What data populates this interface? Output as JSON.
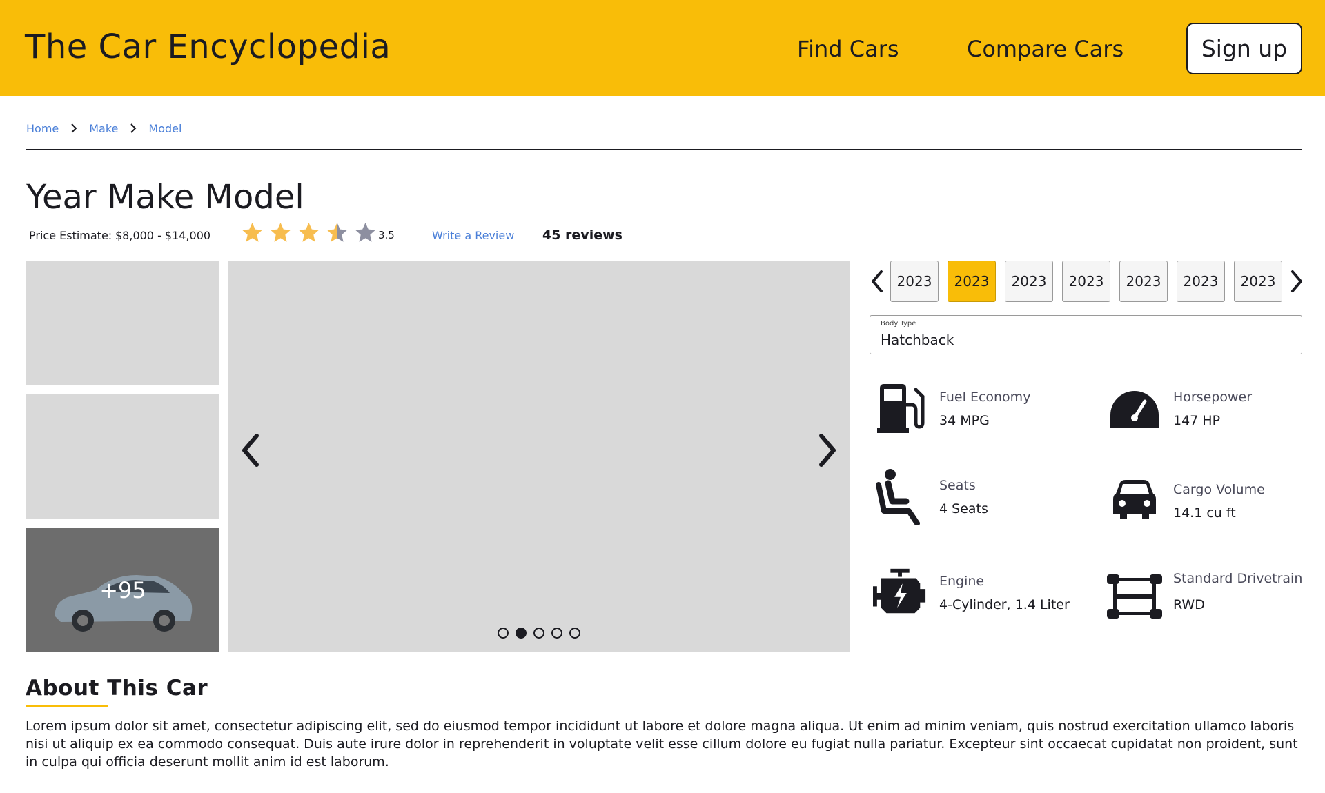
{
  "header": {
    "brand": "The Car Encyclopedia",
    "nav": {
      "find_cars": "Find Cars",
      "compare_cars": "Compare Cars"
    },
    "signup_label": "Sign up",
    "background_color": "#f9bd08"
  },
  "breadcrumb": [
    "Home",
    "Make",
    "Model"
  ],
  "car": {
    "title": "Year Make Model",
    "price_label": "Price Estimate:",
    "price_value": "$8,000 - $14,000",
    "rating": 3.5,
    "rating_text": "3.5",
    "rating_max": 5,
    "write_review": "Write a Review",
    "review_count": "45 reviews"
  },
  "gallery": {
    "more_count": "+95",
    "slide_count": 5,
    "active_slide": 2
  },
  "years": {
    "items": [
      "2023",
      "2023",
      "2023",
      "2023",
      "2023",
      "2023",
      "2023"
    ],
    "active_index": 1
  },
  "body_type": {
    "label": "Body Type",
    "value": "Hatchback"
  },
  "specs": {
    "fuel_economy": {
      "label": "Fuel Economy",
      "value": "34 MPG",
      "icon": "fuel-pump-icon"
    },
    "horsepower": {
      "label": "Horsepower",
      "value": "147 HP",
      "icon": "speedometer-icon"
    },
    "seats": {
      "label": "Seats",
      "value": "4 Seats",
      "icon": "seat-icon"
    },
    "cargo_volume": {
      "label": "Cargo Volume",
      "value": "14.1 cu ft",
      "icon": "car-front-icon"
    },
    "engine": {
      "label": "Engine",
      "value": "4-Cylinder, 1.4 Liter",
      "icon": "engine-icon"
    },
    "drivetrain": {
      "label": "Standard Drivetrain",
      "value": "RWD",
      "icon": "drivetrain-icon"
    }
  },
  "about": {
    "title": "About This Car",
    "text": "Lorem ipsum dolor sit amet, consectetur adipiscing elit, sed do eiusmod tempor incididunt ut labore et dolore magna aliqua. Ut enim ad minim veniam, quis nostrud exercitation ullamco laboris nisi ut aliquip ex ea commodo consequat. Duis aute irure dolor in reprehenderit in voluptate velit esse cillum dolore eu fugiat nulla pariatur. Excepteur sint occaecat cupidatat non proident, sunt in culpa qui officia deserunt mollit anim id est laborum."
  },
  "colors": {
    "accent": "#f9bd08",
    "link": "#4a7fd8",
    "text": "#1b1b21",
    "star_filled": "#f7bd4f",
    "star_empty": "#8d8fa0"
  }
}
